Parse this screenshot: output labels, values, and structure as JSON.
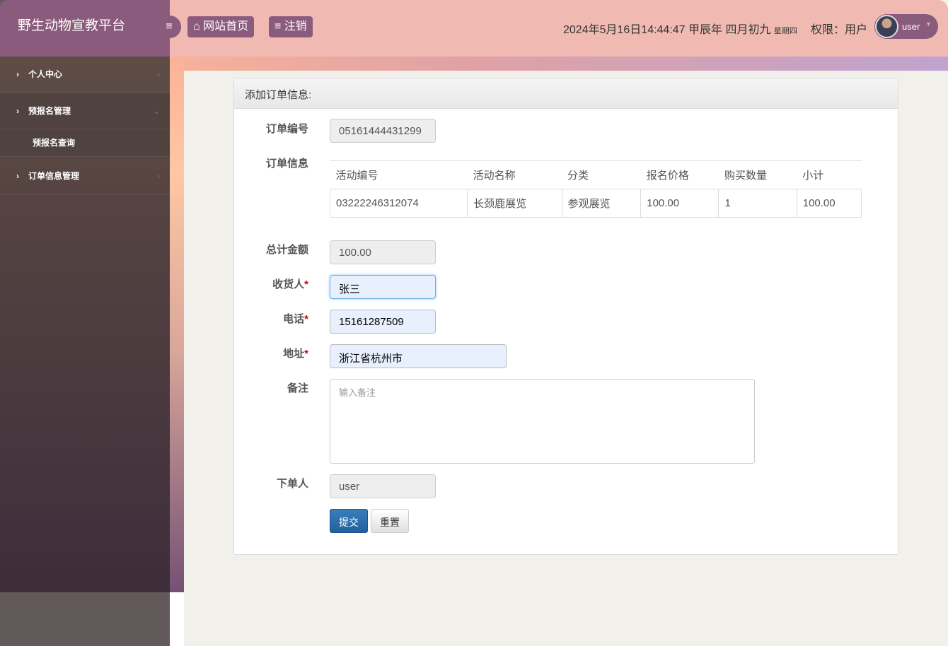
{
  "app": {
    "title": "野生动物宣教平台"
  },
  "sidebar": {
    "items": [
      {
        "label": "个人中心"
      },
      {
        "label": "预报名管理",
        "sub": [
          "预报名查询"
        ]
      },
      {
        "label": "订单信息管理"
      }
    ]
  },
  "header": {
    "home": "网站首页",
    "logout": "注销",
    "datetime": "2024年5月16日14:44:47 甲辰年 四月初九",
    "weekday": "星期四",
    "permission": "权限：用户",
    "user": "user"
  },
  "form": {
    "title": "添加订单信息:",
    "order_no_label": "订单编号",
    "order_no": "05161444431299",
    "order_info_label": "订单信息",
    "columns": [
      "活动编号",
      "活动名称",
      "分类",
      "报名价格",
      "购买数量",
      "小计"
    ],
    "rows": [
      [
        "03222246312074",
        "长颈鹿展览",
        "参观展览",
        "100.00",
        "1",
        "100.00"
      ]
    ],
    "total_label": "总计金额",
    "total": "100.00",
    "receiver_label": "收货人",
    "receiver": "张三",
    "phone_label": "电话",
    "phone": "15161287509",
    "address_label": "地址",
    "address": "浙江省杭州市",
    "note_label": "备注",
    "note_placeholder": "输入备注",
    "orderer_label": "下单人",
    "orderer": "user",
    "required_mark": "*",
    "submit": "提交",
    "reset": "重置"
  }
}
